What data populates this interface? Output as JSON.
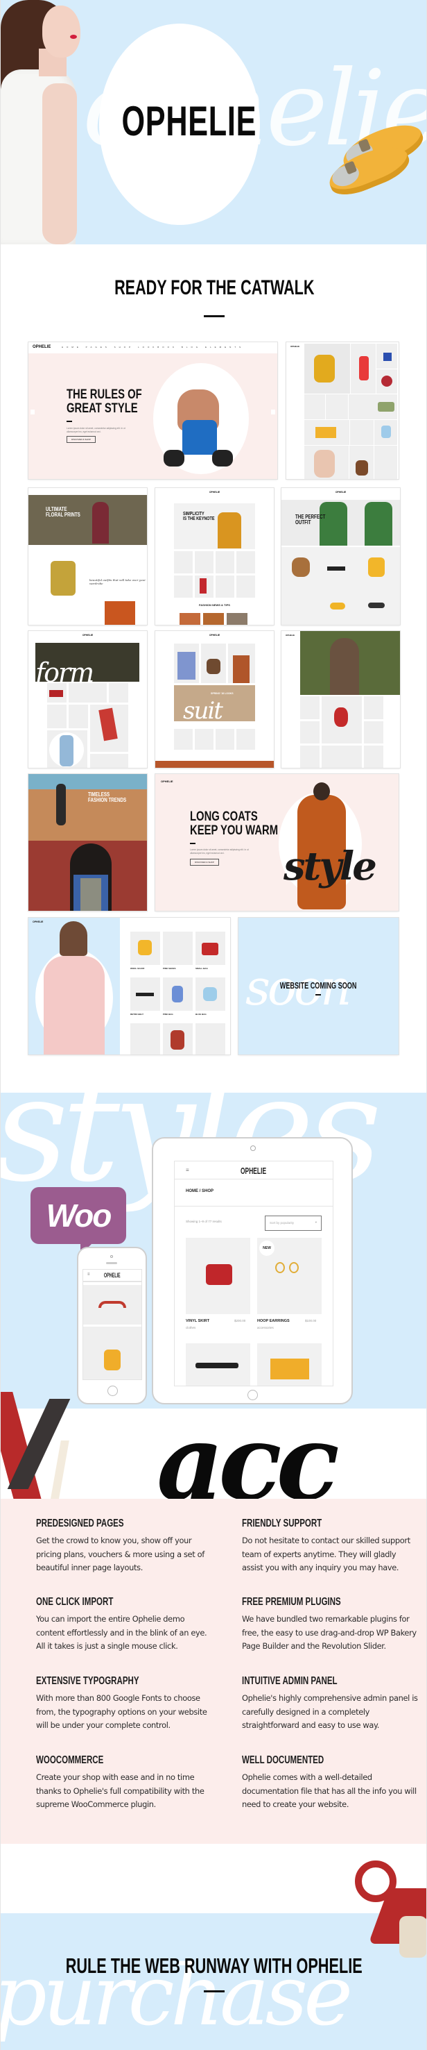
{
  "hero": {
    "logo": "OPHELIE",
    "background_script": "ophelie",
    "colors": {
      "background": "#d6ecfb",
      "circle": "#ffffff",
      "logo": "#0a0a0a"
    }
  },
  "catwalk": {
    "title": "READY FOR THE CATWALK",
    "screenshots": [
      {
        "name": "home-main",
        "logo": "OPHELIE",
        "menu": [
          "HOME",
          "PAGES",
          "SHOP",
          "LOOKBOOK",
          "BLOG",
          "ELEMENTS"
        ],
        "headline": [
          "THE RULES OF",
          "GREAT STYLE"
        ],
        "body": "Lorem ipsum dolor sit amet, consectetur adipiscing elit. In ut ullamcorper leo, eget euismod orci.",
        "button": "DISCOVER & SHOP"
      },
      {
        "name": "home-side-menu",
        "logo": "OPHELIE"
      },
      {
        "name": "home-floral",
        "logo": "OPHELIE",
        "headline": [
          "ULTIMATE",
          "FLORAL PRINTS"
        ]
      },
      {
        "name": "home-simplicity",
        "logo": "OPHELIE",
        "headline": [
          "SIMPLICITY",
          "IS THE KEYNOTE"
        ],
        "section_title": "FASHION NEWS & TIPS"
      },
      {
        "name": "home-perfect-outfit",
        "logo": "OPHELIE",
        "headline": [
          "THE PERFECT",
          "OUTFIT"
        ]
      },
      {
        "name": "home-form",
        "logo": "OPHELIE",
        "script": "form"
      },
      {
        "name": "home-spring",
        "logo": "OPHELIE",
        "headline": [
          "SPRING '18 LOOKS"
        ],
        "script": "suit"
      },
      {
        "name": "home-portrait",
        "logo": "OPHELIE"
      },
      {
        "name": "home-timeless",
        "headline": [
          "TIMELESS",
          "FASHION TRENDS"
        ]
      },
      {
        "name": "home-long-coats",
        "logo": "OPHELIE",
        "headline": [
          "LONG COATS",
          "KEEP YOU WARM"
        ],
        "body": "Lorem ipsum dolor sit amet, consectetur adipiscing elit. In ut ullamcorper leo, eget euismod orci.",
        "button": "DISCOVER & SHOP",
        "script": "style"
      },
      {
        "name": "shop-split",
        "logo": "OPHELIE",
        "products": [
          {
            "name": "WOOL SCARF",
            "price": "$35.00",
            "category": "accessories"
          },
          {
            "name": "PINK SHOES",
            "price": "$50.00",
            "category": "shoes"
          },
          {
            "name": "SMALL BAG",
            "price": "$45.00",
            "category": "bags"
          },
          {
            "name": "RETRO BELT",
            "price": "$25.00",
            "category": "accessories"
          },
          {
            "name": "PINK BAG",
            "price": "$45.00",
            "category": "bags"
          },
          {
            "name": "BLUE BAG",
            "price": "$40.00",
            "category": "bags"
          }
        ]
      },
      {
        "name": "coming-soon",
        "headline": [
          "WEBSITE COMING SOON"
        ],
        "script": "soon"
      }
    ]
  },
  "woocommerce": {
    "badge": "Woo",
    "background_script": "styles",
    "tablet": {
      "logo": "OPHELIE",
      "breadcrumb": "HOME / SHOP",
      "results": "Showing 1–9 of 77 results",
      "sort": "Sort by popularity",
      "badge_new": "NEW",
      "products": [
        {
          "name": "VINYL SKIRT",
          "price": "$200.00",
          "category": "clothes"
        },
        {
          "name": "HOOP EARRINGS",
          "price": "$100.00",
          "category": "accessories"
        }
      ]
    },
    "phone": {
      "logo": "OPHELIE"
    }
  },
  "script_band": {
    "text": "acc"
  },
  "features": [
    {
      "title": "PREDESIGNED PAGES",
      "text": "Get the crowd to know you, show off your pricing plans, vouchers & more using a set of beautiful inner page layouts."
    },
    {
      "title": "FRIENDLY SUPPORT",
      "text": "Do not hesitate to contact our skilled support team of experts anytime. They will gladly assist you with any inquiry you may have."
    },
    {
      "title": "ONE CLICK IMPORT",
      "text": "You can import the entire Ophelie demo content effortlessly and in the blink of an eye. All it takes is just a single mouse click."
    },
    {
      "title": "FREE PREMIUM PLUGINS",
      "text": "We have bundled two remarkable plugins for free, the easy to use drag-and-drop WP Bakery Page Builder and the Revolution Slider."
    },
    {
      "title": "EXTENSIVE TYPOGRAPHY",
      "text": "With more than 800 Google Fonts to choose from, the typography options on your website will be under your complete control."
    },
    {
      "title": "INTUITIVE ADMIN PANEL",
      "text": "Ophelie's highly comprehensive admin panel is carefully designed in a completely straightforward and easy to use way."
    },
    {
      "title": "WOOCOMMERCE",
      "text": "Create your shop with ease and in no time thanks to Ophelie's full compatibility with the supreme WooCommerce plugin."
    },
    {
      "title": "WELL DOCUMENTED",
      "text": "Ophelie comes with a well-detailed documentation file that has all the info you will need to create your website."
    }
  ],
  "cta": {
    "title": "RULE THE WEB RUNWAY WITH OPHELIE",
    "background_script": "purchase"
  },
  "colors": {
    "light_blue": "#d6ecfb",
    "blush_pink": "#fcedeb",
    "woo_purple": "#9b5c8f",
    "text_dark": "#0a0a0a"
  }
}
